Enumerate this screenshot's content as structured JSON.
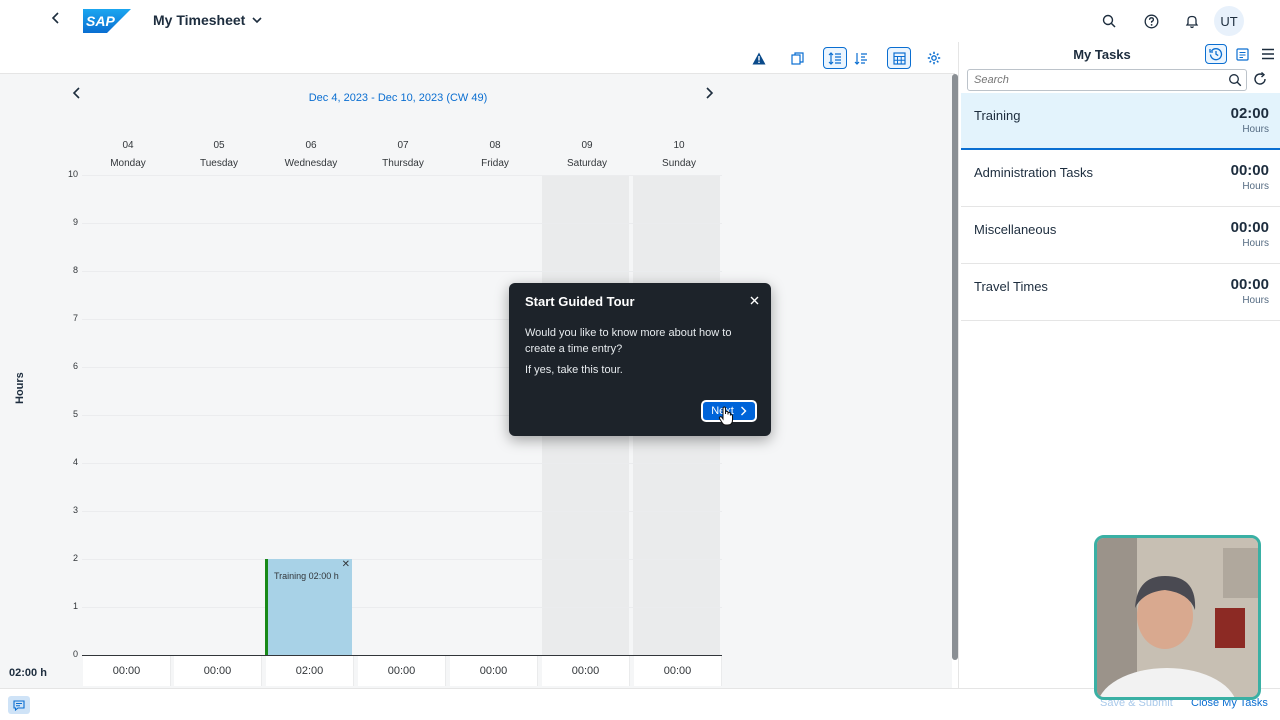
{
  "shell": {
    "app_title": "My Timesheet",
    "avatar_initials": "UT",
    "logo_text": "SAP",
    "icons": [
      "search-icon",
      "help-icon",
      "bell-icon"
    ]
  },
  "toolbar": {
    "icons": [
      "warning-icon",
      "copy-icon",
      "list-view-icon",
      "sort-icon",
      "calendar-view-icon",
      "settings-icon"
    ]
  },
  "calendar": {
    "week_label": "Dec 4, 2023 - Dec 10, 2023 (CW 49)",
    "y_axis_label": "Hours",
    "y_ticks": [
      "10",
      "9",
      "8",
      "7",
      "6",
      "5",
      "4",
      "3",
      "2",
      "1",
      "0"
    ],
    "days": [
      {
        "num": "04",
        "name": "Monday",
        "total": "00:00"
      },
      {
        "num": "05",
        "name": "Tuesday",
        "total": "00:00"
      },
      {
        "num": "06",
        "name": "Wednesday",
        "total": "02:00"
      },
      {
        "num": "07",
        "name": "Thursday",
        "total": "00:00"
      },
      {
        "num": "08",
        "name": "Friday",
        "total": "00:00"
      },
      {
        "num": "09",
        "name": "Saturday",
        "total": "00:00"
      },
      {
        "num": "10",
        "name": "Sunday",
        "total": "00:00"
      }
    ],
    "entry": {
      "label": "Training 02:00 h",
      "hours": 2,
      "day_index": 2
    },
    "week_total": "02:00 h"
  },
  "dialog": {
    "title": "Start Guided Tour",
    "body1": "Would you like to know more about how to create a time entry?",
    "body2": "If yes, take this tour.",
    "next_label": "Next"
  },
  "tasks": {
    "title": "My Tasks",
    "search_placeholder": "Search",
    "items": [
      {
        "name": "Training",
        "value": "02:00",
        "unit": "Hours"
      },
      {
        "name": "Administration Tasks",
        "value": "00:00",
        "unit": "Hours"
      },
      {
        "name": "Miscellaneous",
        "value": "00:00",
        "unit": "Hours"
      },
      {
        "name": "Travel Times",
        "value": "00:00",
        "unit": "Hours"
      }
    ]
  },
  "footer": {
    "save_submit": "Save & Submit",
    "close_tasks": "Close My Tasks"
  },
  "colors": {
    "accent": "#0a6ed1",
    "entry_fill": "#a8d2e7",
    "entry_marker": "#188918",
    "dialog_bg": "#1d232a"
  }
}
